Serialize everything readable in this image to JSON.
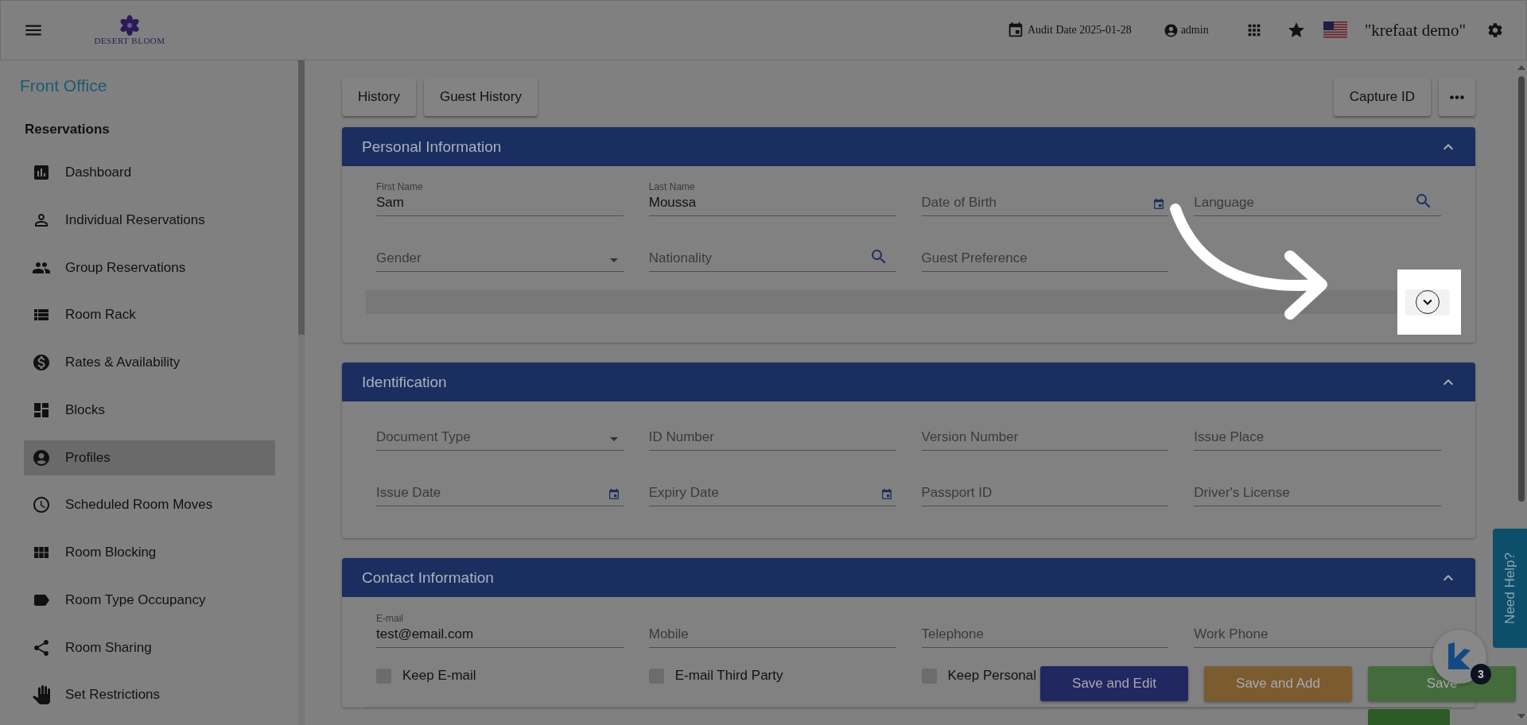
{
  "header": {
    "logo_text": "DESERT BLOOM",
    "audit_date": "Audit Date 2025-01-28",
    "user": "admin",
    "account": "\"krefaat demo\""
  },
  "sidebar": {
    "title": "Front Office",
    "section": "Reservations",
    "items": [
      {
        "label": "Dashboard",
        "selected": false
      },
      {
        "label": "Individual Reservations",
        "selected": false
      },
      {
        "label": "Group Reservations",
        "selected": false
      },
      {
        "label": "Room Rack",
        "selected": false
      },
      {
        "label": "Rates & Availability",
        "selected": false
      },
      {
        "label": "Blocks",
        "selected": false
      },
      {
        "label": "Profiles",
        "selected": true
      },
      {
        "label": "Scheduled Room Moves",
        "selected": false
      },
      {
        "label": "Room Blocking",
        "selected": false
      },
      {
        "label": "Room Type Occupancy",
        "selected": false
      },
      {
        "label": "Room Sharing",
        "selected": false
      },
      {
        "label": "Set Restrictions",
        "selected": false
      }
    ]
  },
  "toolbar": {
    "left_buttons": [
      "History",
      "Guest History"
    ],
    "right_buttons": [
      "Capture ID"
    ]
  },
  "panels": [
    {
      "title": "Personal Information",
      "expanded": true,
      "has_subsection": true,
      "rows": [
        [
          {
            "kind": "text",
            "label": "First Name",
            "value": "Sam"
          },
          {
            "kind": "text",
            "label": "Last Name",
            "value": "Moussa"
          },
          {
            "kind": "date",
            "placeholder": "Date of Birth"
          },
          {
            "kind": "search",
            "placeholder": "Language"
          }
        ],
        [
          {
            "kind": "select",
            "placeholder": "Gender"
          },
          {
            "kind": "search",
            "placeholder": "Nationality"
          },
          {
            "kind": "text",
            "placeholder": "Guest Preference"
          }
        ]
      ]
    },
    {
      "title": "Identification",
      "expanded": true,
      "has_subsection": false,
      "rows": [
        [
          {
            "kind": "select",
            "placeholder": "Document Type"
          },
          {
            "kind": "text",
            "placeholder": "ID Number"
          },
          {
            "kind": "text",
            "placeholder": "Version Number"
          },
          {
            "kind": "text",
            "placeholder": "Issue Place"
          }
        ],
        [
          {
            "kind": "date",
            "placeholder": "Issue Date"
          },
          {
            "kind": "date",
            "placeholder": "Expiry Date"
          },
          {
            "kind": "text",
            "placeholder": "Passport ID"
          },
          {
            "kind": "text",
            "placeholder": "Driver's License"
          }
        ]
      ]
    },
    {
      "title": "Contact Information",
      "expanded": true,
      "has_subsection": false,
      "rows": [
        [
          {
            "kind": "text",
            "label": "E-mail",
            "value": "test@email.com"
          },
          {
            "kind": "text",
            "placeholder": "Mobile"
          },
          {
            "kind": "text",
            "placeholder": "Telephone"
          },
          {
            "kind": "text",
            "placeholder": "Work Phone"
          }
        ],
        [
          {
            "kind": "checkbox",
            "label": "Keep E-mail",
            "checked": false
          },
          {
            "kind": "checkbox",
            "label": "E-mail Third Party",
            "checked": false
          },
          {
            "kind": "checkbox",
            "label": "Keep Personal",
            "checked": false
          }
        ]
      ]
    }
  ],
  "actions": [
    {
      "label": "Save and Edit",
      "kind": "edit"
    },
    {
      "label": "Save and Add",
      "kind": "add"
    },
    {
      "label": "Save",
      "kind": "save"
    }
  ],
  "help_tab": "Need Help?",
  "chat": {
    "badge": "3"
  }
}
